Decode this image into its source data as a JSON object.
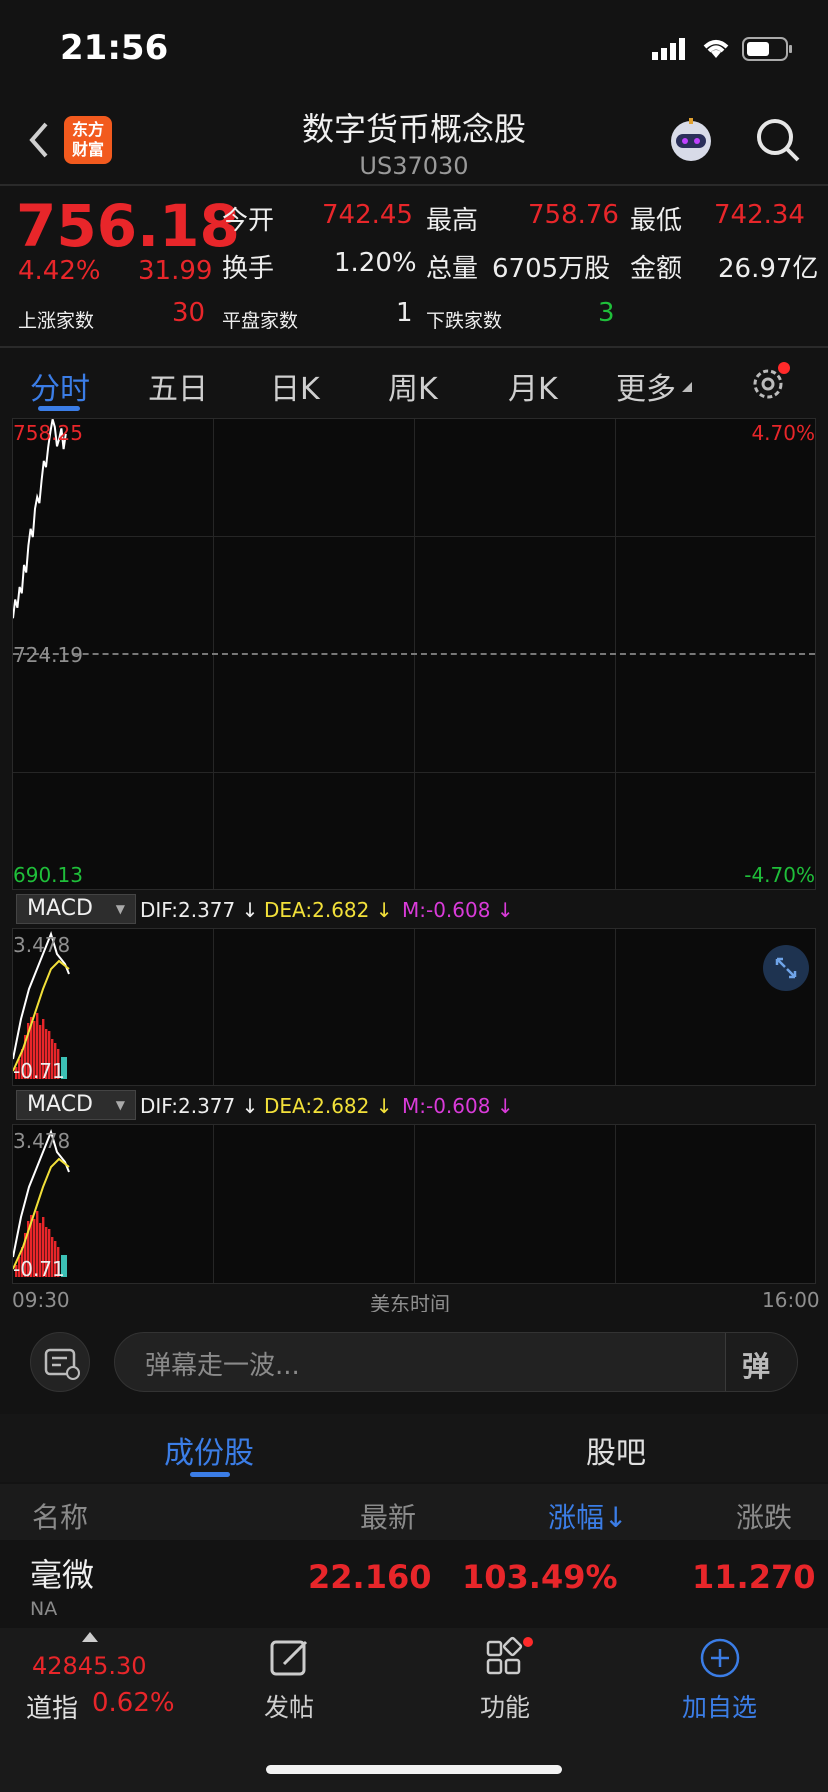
{
  "status": {
    "time": "21:56"
  },
  "header": {
    "logo_line1": "东方",
    "logo_line2": "财富",
    "title": "数字货币概念股",
    "code": "US37030"
  },
  "quote": {
    "price": "756.18",
    "change_pct": "4.42%",
    "change": "31.99",
    "open_label": "今开",
    "open": "742.45",
    "high_label": "最高",
    "high": "758.76",
    "low_label": "最低",
    "low": "742.34",
    "turnover_label": "换手",
    "turnover": "1.20%",
    "volume_label": "总量",
    "volume": "6705万股",
    "amount_label": "金额",
    "amount": "26.97亿",
    "up_label": "上涨家数",
    "up_count": "30",
    "flat_label": "平盘家数",
    "flat_count": "1",
    "down_label": "下跌家数",
    "down_count": "3"
  },
  "tabs": [
    "分时",
    "五日",
    "日K",
    "周K",
    "月K",
    "更多"
  ],
  "chart_data": [
    {
      "type": "line",
      "title": "",
      "y_left_labels": [
        "758.25",
        "724.19",
        "690.13"
      ],
      "y_right_labels": [
        "4.70%",
        "-4.70%"
      ],
      "reference_price": 724.19,
      "ylim": [
        690.13,
        758.25
      ],
      "x_labels": [
        "09:30",
        "美东时间",
        "16:00"
      ],
      "series": [
        {
          "values": [
            729.5,
            732.2,
            731.0,
            734.0,
            733.1,
            737.2,
            736.1,
            740.0,
            742.4,
            741.2,
            745.3,
            747.0,
            746.1,
            749.4,
            752.2,
            751.3,
            754.2,
            756.4,
            758.2,
            757.1,
            754.3,
            755.4,
            756.9,
            753.9,
            756.1
          ]
        }
      ]
    },
    {
      "type": "bar",
      "title": "MACD",
      "labels": {
        "dif": "DIF:2.377 ↓",
        "dea": "DEA:2.682 ↓",
        "m": "M:-0.608 ↓"
      },
      "y_labels": [
        "3.478",
        "-0.71"
      ],
      "ylim": [
        -0.71,
        3.478
      ]
    },
    {
      "type": "bar",
      "title": "MACD",
      "labels": {
        "dif": "DIF:2.377 ↓",
        "dea": "DEA:2.682 ↓",
        "m": "M:-0.608 ↓"
      },
      "y_labels": [
        "3.478",
        "-0.71"
      ],
      "ylim": [
        -0.71,
        3.478
      ]
    }
  ],
  "macd": {
    "select_label": "MACD"
  },
  "danmu": {
    "placeholder": "弹幕走一波...",
    "send_label": "弹"
  },
  "section": {
    "tab1": "成份股",
    "tab2": "股吧"
  },
  "columns": {
    "name": "名称",
    "latest": "最新",
    "change_pct": "涨幅↓",
    "change": "涨跌"
  },
  "rows": [
    {
      "name": "毫微",
      "code": "NA",
      "latest": "22.160",
      "change_pct": "103.49%",
      "change": "11.270"
    }
  ],
  "bottom": {
    "index_value": "42845.30",
    "index_name": "道指",
    "index_pct": "0.62%",
    "post_label": "发帖",
    "func_label": "功能",
    "add_label": "加自选"
  },
  "colors": {
    "red": "#e8262a",
    "green": "#1fbf3a",
    "blue": "#3b7de6",
    "yellow": "#f2e03a",
    "magenta": "#d93bd9"
  }
}
